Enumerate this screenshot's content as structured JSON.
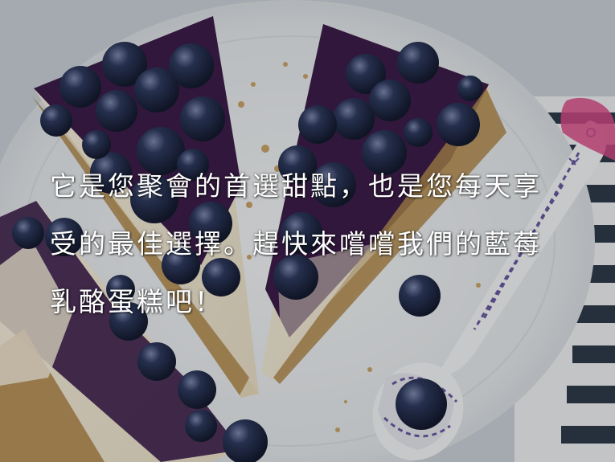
{
  "caption": {
    "text": "它是您聚會的首選甜點，也是您每天享受的最佳選擇。趕快來嚐嚐我們的藍莓乳酪蛋糕吧！"
  },
  "colors": {
    "background": "#cfd6dc",
    "plate": "#eceff1",
    "cheesecake": "#f4ecd9",
    "crust": "#b0894f",
    "blueberry": "#26304f",
    "blueberry_sauce": "#3c1d4a",
    "spoon_pattern": "#6a5aa0",
    "towel_stripe": "#2f3a4a",
    "caption_text": "#ffffff"
  },
  "photo": {
    "subject": "blueberry-cheesecake-slices",
    "props": [
      "plate-icon",
      "spoon-icon",
      "striped-towel-icon",
      "blueberry-icon"
    ]
  }
}
